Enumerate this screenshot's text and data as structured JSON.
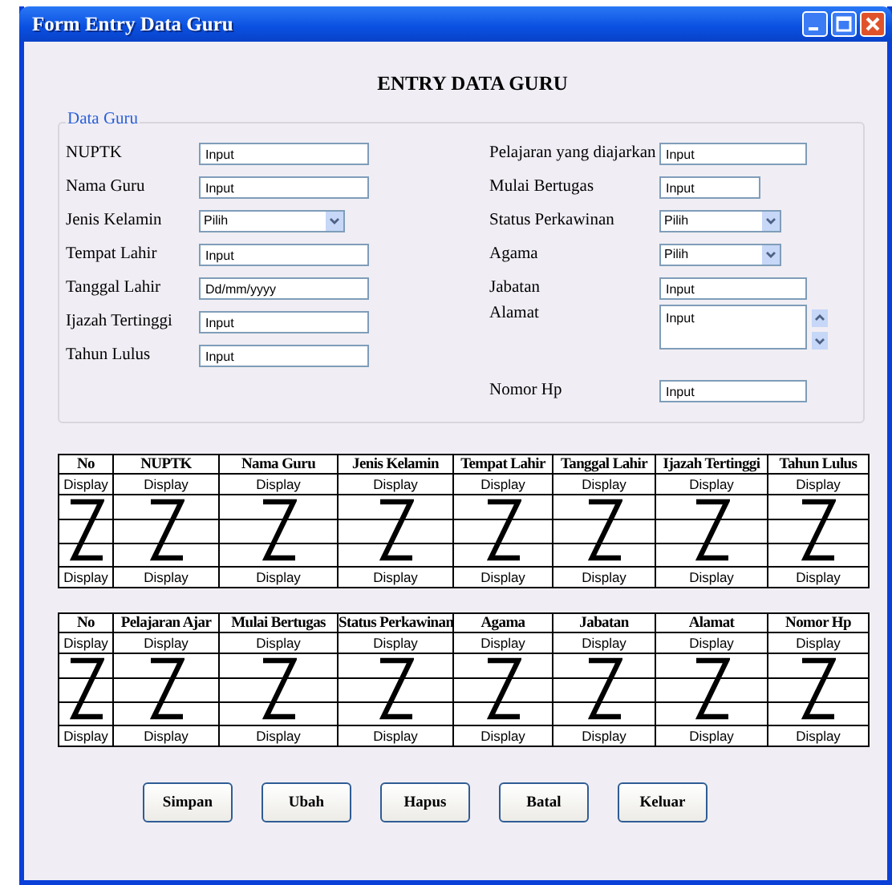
{
  "window": {
    "title": "Form Entry Data Guru"
  },
  "heading": "ENTRY DATA GURU",
  "group": {
    "legend": "Data Guru",
    "left_fields": [
      {
        "label": "NUPTK",
        "kind": "input",
        "value": "Input"
      },
      {
        "label": "Nama Guru",
        "kind": "input",
        "value": "Input"
      },
      {
        "label": "Jenis Kelamin",
        "kind": "select",
        "value": "Pilih"
      },
      {
        "label": "Tempat Lahir",
        "kind": "input",
        "value": "Input"
      },
      {
        "label": "Tanggal Lahir",
        "kind": "input",
        "value": "Dd/mm/yyyy"
      },
      {
        "label": "Ijazah Tertinggi",
        "kind": "input",
        "value": "Input"
      },
      {
        "label": "Tahun Lulus",
        "kind": "input",
        "value": "Input"
      }
    ],
    "right_fields": [
      {
        "label": "Pelajaran yang diajarkan",
        "kind": "input",
        "value": "Input"
      },
      {
        "label": "Mulai Bertugas",
        "kind": "short",
        "value": "Input"
      },
      {
        "label": "Status Perkawinan",
        "kind": "select",
        "value": "Pilih"
      },
      {
        "label": "Agama",
        "kind": "select",
        "value": "Pilih"
      },
      {
        "label": "Jabatan",
        "kind": "input",
        "value": "Input"
      },
      {
        "label": "Alamat",
        "kind": "textarea",
        "value": "Input"
      },
      {
        "label": "Nomor Hp",
        "kind": "input",
        "value": "Input"
      }
    ]
  },
  "tables": [
    {
      "columns": [
        "No",
        "NUPTK",
        "Nama Guru",
        "Jenis Kelamin",
        "Tempat Lahir",
        "Tanggal Lahir",
        "Ijazah Tertinggi",
        "Tahun Lulus"
      ],
      "first_row": [
        "Display",
        "Display",
        "Display",
        "Display",
        "Display",
        "Display",
        "Display",
        "Display"
      ],
      "last_row": [
        "Display",
        "Display",
        "Display",
        "Display",
        "Display",
        "Display",
        "Display",
        "Display"
      ]
    },
    {
      "columns": [
        "No",
        "Pelajaran Ajar",
        "Mulai Bertugas",
        "Status Perkawinan",
        "Agama",
        "Jabatan",
        "Alamat",
        "Nomor Hp"
      ],
      "first_row": [
        "Display",
        "Display",
        "Display",
        "Display",
        "Display",
        "Display",
        "Display",
        "Display"
      ],
      "last_row": [
        "Display",
        "Display",
        "Display",
        "Display",
        "Display",
        "Display",
        "Display",
        "Display"
      ]
    }
  ],
  "buttons": [
    "Simpan",
    "Ubah",
    "Hapus",
    "Batal",
    "Keluar"
  ]
}
